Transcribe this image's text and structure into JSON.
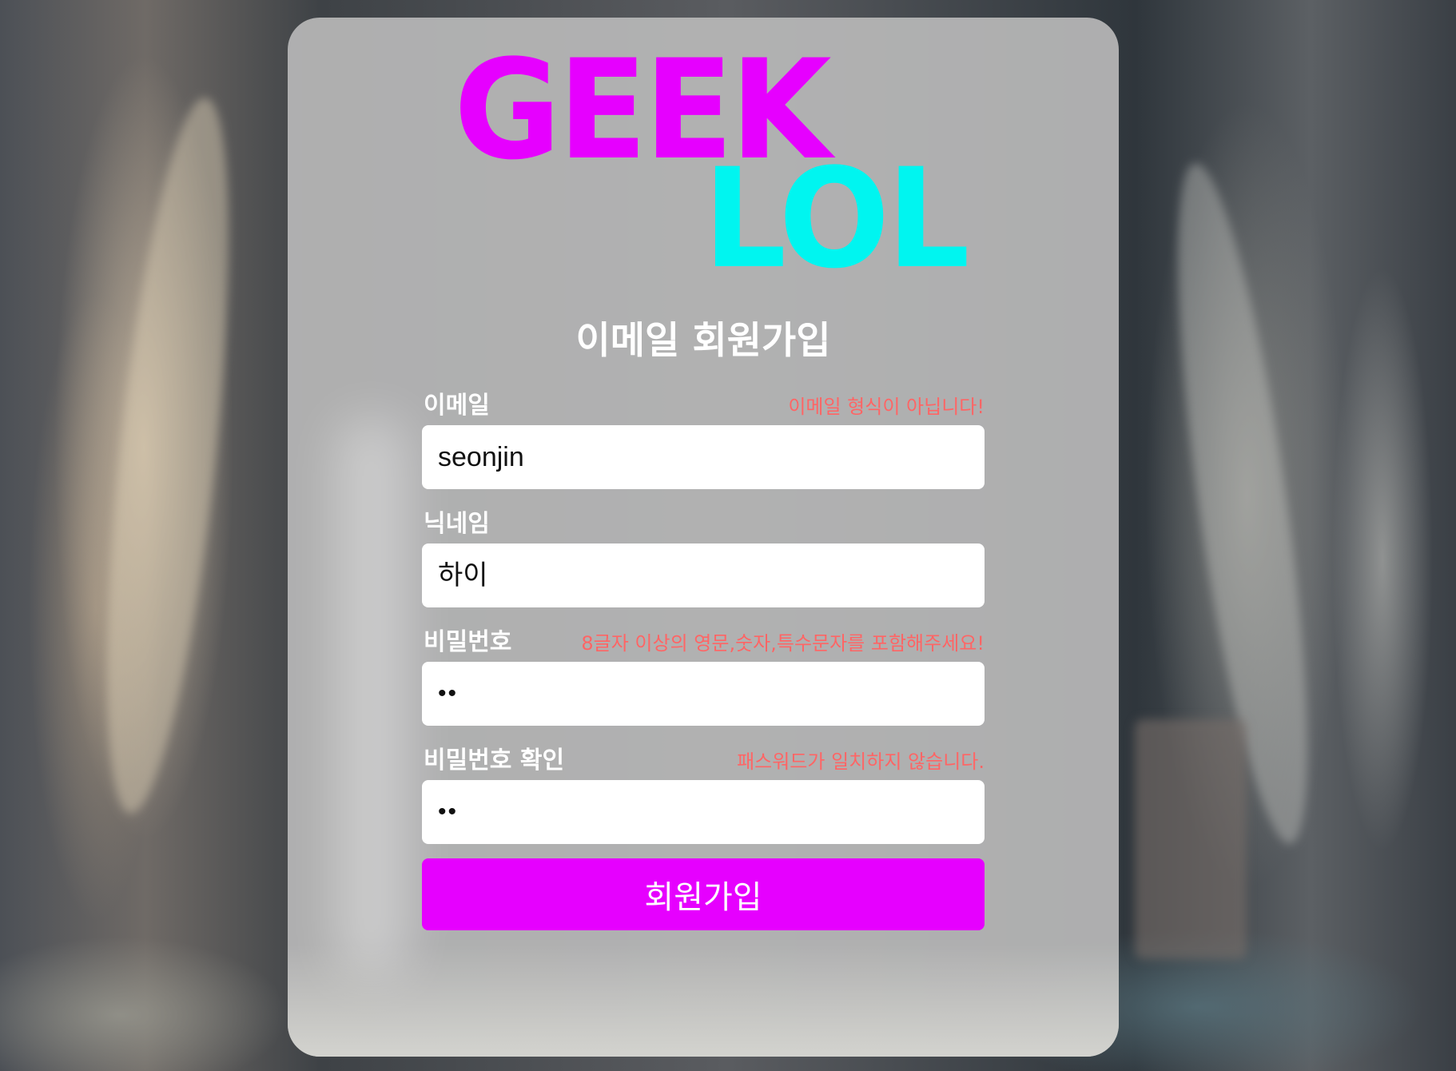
{
  "logo": {
    "line1": "GEEK",
    "line2": "LOL",
    "line1_color": "#e600ff",
    "line2_color": "#00f5f0"
  },
  "form": {
    "title": "이메일 회원가입",
    "email": {
      "label": "이메일",
      "error": "이메일 형식이 아닙니다!",
      "value": "seonjin"
    },
    "nickname": {
      "label": "닉네임",
      "value": "하이"
    },
    "password": {
      "label": "비밀번호",
      "error": "8글자 이상의 영문,숫자,특수문자를 포함해주세요!",
      "value": "••"
    },
    "password_confirm": {
      "label": "비밀번호 확인",
      "error": "패스워드가 일치하지 않습니다.",
      "value": "••"
    },
    "submit_label": "회원가입"
  },
  "colors": {
    "accent": "#e600ff",
    "error": "#ff6565",
    "card": "#b9b9b9"
  }
}
